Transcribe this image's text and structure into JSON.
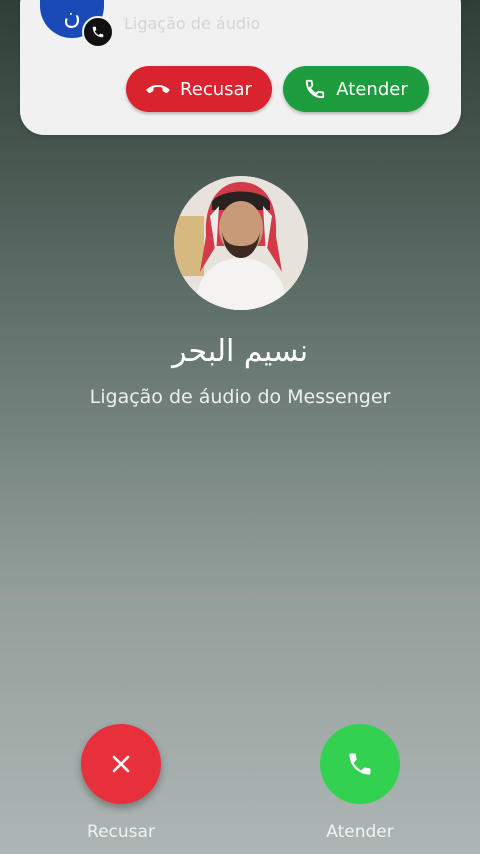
{
  "notification": {
    "avatar_letter": "ن",
    "subtitle": "Ligação de áudio",
    "decline_label": "Recusar",
    "accept_label": "Atender"
  },
  "caller": {
    "name": "نسيم البحر",
    "call_type": "Ligação de áudio do Messenger"
  },
  "actions": {
    "decline_label": "Recusar",
    "accept_label": "Atender"
  },
  "colors": {
    "decline": "#e8303c",
    "accept": "#32d14f",
    "avatar": "#1a49b8"
  },
  "icons": {
    "decline_pill": "phone-hangup-icon",
    "accept_pill": "phone-icon",
    "decline_round": "close-icon",
    "accept_round": "phone-icon",
    "badge": "phone-icon"
  }
}
